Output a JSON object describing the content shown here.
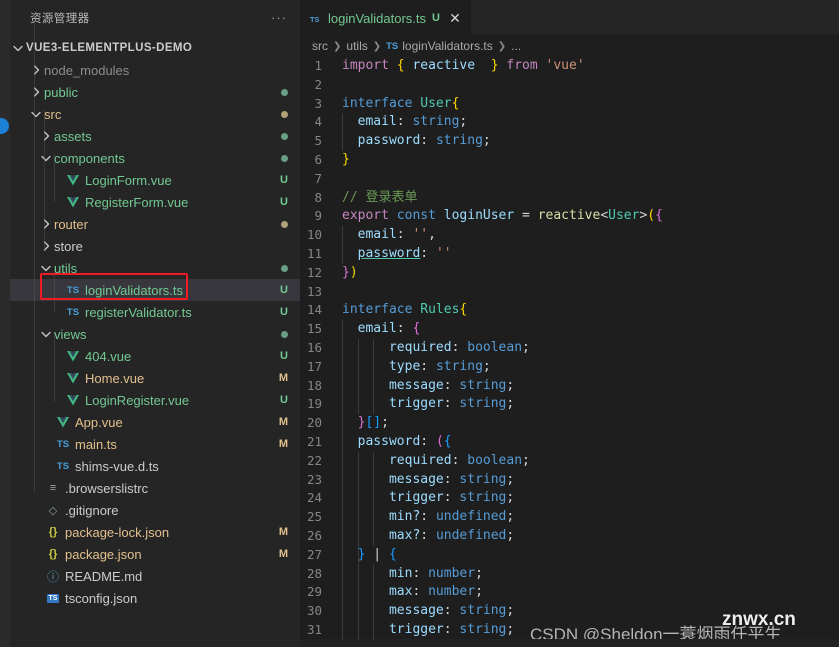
{
  "sidebar": {
    "title": "资源管理器",
    "more_label": "···",
    "root": {
      "label": "VUE3-ELEMENTPLUS-DEMO"
    },
    "items": [
      {
        "label": "node_modules",
        "icon": "chevron-right-icon",
        "kind": "folder",
        "color": "gray",
        "indent": 1,
        "badge": "",
        "dot": ""
      },
      {
        "label": "public",
        "icon": "chevron-right-icon",
        "kind": "folder",
        "color": "green",
        "indent": 1,
        "badge": "",
        "dot": "u"
      },
      {
        "label": "src",
        "icon": "chevron-down-icon",
        "kind": "folder",
        "color": "orange",
        "indent": 1,
        "badge": "",
        "dot": "m"
      },
      {
        "label": "assets",
        "icon": "chevron-right-icon",
        "kind": "folder",
        "color": "green",
        "indent": 2,
        "badge": "",
        "dot": "u"
      },
      {
        "label": "components",
        "icon": "chevron-down-icon",
        "kind": "folder",
        "color": "green",
        "indent": 2,
        "badge": "",
        "dot": "u"
      },
      {
        "label": "LoginForm.vue",
        "icon": "vue-icon",
        "kind": "file",
        "color": "green",
        "indent": 3,
        "badge": "U",
        "dot": ""
      },
      {
        "label": "RegisterForm.vue",
        "icon": "vue-icon",
        "kind": "file",
        "color": "green",
        "indent": 3,
        "badge": "U",
        "dot": ""
      },
      {
        "label": "router",
        "icon": "chevron-right-icon",
        "kind": "folder",
        "color": "orange",
        "indent": 2,
        "badge": "",
        "dot": "m"
      },
      {
        "label": "store",
        "icon": "chevron-right-icon",
        "kind": "folder",
        "color": "plain",
        "indent": 2,
        "badge": "",
        "dot": ""
      },
      {
        "label": "utils",
        "icon": "chevron-down-icon",
        "kind": "folder",
        "color": "green",
        "indent": 2,
        "badge": "",
        "dot": "u"
      },
      {
        "label": "loginValidators.ts",
        "icon": "ts-icon",
        "kind": "file",
        "color": "green",
        "indent": 3,
        "badge": "U",
        "dot": "",
        "selected": true,
        "highlighted": true
      },
      {
        "label": "registerValidator.ts",
        "icon": "ts-icon",
        "kind": "file",
        "color": "green",
        "indent": 3,
        "badge": "U",
        "dot": ""
      },
      {
        "label": "views",
        "icon": "chevron-down-icon",
        "kind": "folder",
        "color": "green",
        "indent": 2,
        "badge": "",
        "dot": "u"
      },
      {
        "label": "404.vue",
        "icon": "vue-icon",
        "kind": "file",
        "color": "green",
        "indent": 3,
        "badge": "U",
        "dot": ""
      },
      {
        "label": "Home.vue",
        "icon": "vue-icon",
        "kind": "file",
        "color": "orange",
        "indent": 3,
        "badge": "M",
        "dot": ""
      },
      {
        "label": "LoginRegister.vue",
        "icon": "vue-icon",
        "kind": "file",
        "color": "green",
        "indent": 3,
        "badge": "U",
        "dot": ""
      },
      {
        "label": "App.vue",
        "icon": "vue-icon",
        "kind": "file",
        "color": "orange",
        "indent": 2,
        "badge": "M",
        "dot": ""
      },
      {
        "label": "main.ts",
        "icon": "ts-icon",
        "kind": "file",
        "color": "orange",
        "indent": 2,
        "badge": "M",
        "dot": ""
      },
      {
        "label": "shims-vue.d.ts",
        "icon": "ts-icon",
        "kind": "file",
        "color": "plain",
        "indent": 2,
        "badge": "",
        "dot": ""
      },
      {
        "label": ".browserslistrc",
        "icon": "config-icon",
        "kind": "file",
        "color": "plain",
        "indent": 1,
        "badge": "",
        "dot": ""
      },
      {
        "label": ".gitignore",
        "icon": "gitignore-icon",
        "kind": "file",
        "color": "plain",
        "indent": 1,
        "badge": "",
        "dot": ""
      },
      {
        "label": "package-lock.json",
        "icon": "json-icon",
        "kind": "file",
        "color": "orange",
        "indent": 1,
        "badge": "M",
        "dot": ""
      },
      {
        "label": "package.json",
        "icon": "json-icon",
        "kind": "file",
        "color": "orange",
        "indent": 1,
        "badge": "M",
        "dot": ""
      },
      {
        "label": "README.md",
        "icon": "markdown-icon",
        "kind": "file",
        "color": "plain",
        "indent": 1,
        "badge": "",
        "dot": ""
      },
      {
        "label": "tsconfig.json",
        "icon": "ts-config-icon",
        "kind": "file",
        "color": "plain",
        "indent": 1,
        "badge": "",
        "dot": ""
      }
    ]
  },
  "editor": {
    "tab": {
      "name": "loginValidators.ts",
      "badge": "U",
      "close_label": "✕",
      "icon": "ts-icon"
    },
    "breadcrumb": [
      "src",
      "utils",
      "loginValidators.ts",
      "..."
    ],
    "lines": [
      {
        "n": "1",
        "tokens": [
          {
            "t": "import",
            "c": "k"
          },
          {
            "t": " ",
            "c": "pn"
          },
          {
            "t": "{",
            "c": "br1"
          },
          {
            "t": " ",
            "c": "pn"
          },
          {
            "t": "reactive",
            "c": "var"
          },
          {
            "t": "  ",
            "c": "pn"
          },
          {
            "t": "}",
            "c": "br1"
          },
          {
            "t": " ",
            "c": "pn"
          },
          {
            "t": "from",
            "c": "k"
          },
          {
            "t": " ",
            "c": "pn"
          },
          {
            "t": "'vue'",
            "c": "str"
          }
        ]
      },
      {
        "n": "2",
        "tokens": []
      },
      {
        "n": "3",
        "tokens": [
          {
            "t": "interface",
            "c": "kw2"
          },
          {
            "t": " ",
            "c": "pn"
          },
          {
            "t": "User",
            "c": "typ"
          },
          {
            "t": "{",
            "c": "br1"
          }
        ]
      },
      {
        "n": "4",
        "tokens": [
          {
            "t": "  ",
            "c": "pn"
          },
          {
            "t": "email",
            "c": "var"
          },
          {
            "t": ": ",
            "c": "pn"
          },
          {
            "t": "string",
            "c": "kw2"
          },
          {
            "t": ";",
            "c": "pn"
          }
        ]
      },
      {
        "n": "5",
        "tokens": [
          {
            "t": "  ",
            "c": "pn"
          },
          {
            "t": "password",
            "c": "var"
          },
          {
            "t": ": ",
            "c": "pn"
          },
          {
            "t": "string",
            "c": "kw2"
          },
          {
            "t": ";",
            "c": "pn"
          }
        ]
      },
      {
        "n": "6",
        "tokens": [
          {
            "t": "}",
            "c": "br1"
          }
        ]
      },
      {
        "n": "7",
        "tokens": []
      },
      {
        "n": "8",
        "tokens": [
          {
            "t": "// 登录表单",
            "c": "cmt"
          }
        ]
      },
      {
        "n": "9",
        "tokens": [
          {
            "t": "export",
            "c": "k"
          },
          {
            "t": " ",
            "c": "pn"
          },
          {
            "t": "const",
            "c": "kw2"
          },
          {
            "t": " ",
            "c": "pn"
          },
          {
            "t": "loginUser",
            "c": "var"
          },
          {
            "t": " ",
            "c": "pn"
          },
          {
            "t": "=",
            "c": "op"
          },
          {
            "t": " ",
            "c": "pn"
          },
          {
            "t": "reactive",
            "c": "fn"
          },
          {
            "t": "<",
            "c": "pn"
          },
          {
            "t": "User",
            "c": "typ"
          },
          {
            "t": ">",
            "c": "pn"
          },
          {
            "t": "(",
            "c": "br1"
          },
          {
            "t": "{",
            "c": "br2"
          }
        ]
      },
      {
        "n": "10",
        "tokens": [
          {
            "t": "  ",
            "c": "pn"
          },
          {
            "t": "email",
            "c": "var"
          },
          {
            "t": ": ",
            "c": "pn"
          },
          {
            "t": "''",
            "c": "str"
          },
          {
            "t": ",",
            "c": "pn"
          }
        ]
      },
      {
        "n": "11",
        "tokens": [
          {
            "t": "  ",
            "c": "pn"
          },
          {
            "t": "password",
            "c": "var spell"
          },
          {
            "t": ": ",
            "c": "pn"
          },
          {
            "t": "''",
            "c": "str"
          }
        ]
      },
      {
        "n": "12",
        "tokens": [
          {
            "t": "}",
            "c": "br2"
          },
          {
            "t": ")",
            "c": "br1"
          }
        ]
      },
      {
        "n": "13",
        "tokens": []
      },
      {
        "n": "14",
        "tokens": [
          {
            "t": "interface",
            "c": "kw2"
          },
          {
            "t": " ",
            "c": "pn"
          },
          {
            "t": "Rules",
            "c": "typ"
          },
          {
            "t": "{",
            "c": "br1"
          }
        ]
      },
      {
        "n": "15",
        "tokens": [
          {
            "t": "  ",
            "c": "pn"
          },
          {
            "t": "email",
            "c": "var"
          },
          {
            "t": ": ",
            "c": "pn"
          },
          {
            "t": "{",
            "c": "br2"
          }
        ]
      },
      {
        "n": "16",
        "tokens": [
          {
            "t": "      ",
            "c": "pn"
          },
          {
            "t": "required",
            "c": "var"
          },
          {
            "t": ": ",
            "c": "pn"
          },
          {
            "t": "boolean",
            "c": "kw2"
          },
          {
            "t": ";",
            "c": "pn"
          }
        ]
      },
      {
        "n": "17",
        "tokens": [
          {
            "t": "      ",
            "c": "pn"
          },
          {
            "t": "type",
            "c": "var"
          },
          {
            "t": ": ",
            "c": "pn"
          },
          {
            "t": "string",
            "c": "kw2"
          },
          {
            "t": ";",
            "c": "pn"
          }
        ]
      },
      {
        "n": "18",
        "tokens": [
          {
            "t": "      ",
            "c": "pn"
          },
          {
            "t": "message",
            "c": "var"
          },
          {
            "t": ": ",
            "c": "pn"
          },
          {
            "t": "string",
            "c": "kw2"
          },
          {
            "t": ";",
            "c": "pn"
          }
        ]
      },
      {
        "n": "19",
        "tokens": [
          {
            "t": "      ",
            "c": "pn"
          },
          {
            "t": "trigger",
            "c": "var"
          },
          {
            "t": ": ",
            "c": "pn"
          },
          {
            "t": "string",
            "c": "kw2"
          },
          {
            "t": ";",
            "c": "pn"
          }
        ]
      },
      {
        "n": "20",
        "tokens": [
          {
            "t": "  ",
            "c": "pn"
          },
          {
            "t": "}",
            "c": "br2"
          },
          {
            "t": "[]",
            "c": "br3"
          },
          {
            "t": ";",
            "c": "pn"
          }
        ]
      },
      {
        "n": "21",
        "tokens": [
          {
            "t": "  ",
            "c": "pn"
          },
          {
            "t": "password",
            "c": "var"
          },
          {
            "t": ": ",
            "c": "pn"
          },
          {
            "t": "(",
            "c": "br2"
          },
          {
            "t": "{",
            "c": "br3"
          }
        ]
      },
      {
        "n": "22",
        "tokens": [
          {
            "t": "      ",
            "c": "pn"
          },
          {
            "t": "required",
            "c": "var"
          },
          {
            "t": ": ",
            "c": "pn"
          },
          {
            "t": "boolean",
            "c": "kw2"
          },
          {
            "t": ";",
            "c": "pn"
          }
        ]
      },
      {
        "n": "23",
        "tokens": [
          {
            "t": "      ",
            "c": "pn"
          },
          {
            "t": "message",
            "c": "var"
          },
          {
            "t": ": ",
            "c": "pn"
          },
          {
            "t": "string",
            "c": "kw2"
          },
          {
            "t": ";",
            "c": "pn"
          }
        ]
      },
      {
        "n": "24",
        "tokens": [
          {
            "t": "      ",
            "c": "pn"
          },
          {
            "t": "trigger",
            "c": "var"
          },
          {
            "t": ": ",
            "c": "pn"
          },
          {
            "t": "string",
            "c": "kw2"
          },
          {
            "t": ";",
            "c": "pn"
          }
        ]
      },
      {
        "n": "25",
        "tokens": [
          {
            "t": "      ",
            "c": "pn"
          },
          {
            "t": "min?",
            "c": "var"
          },
          {
            "t": ": ",
            "c": "pn"
          },
          {
            "t": "undefined",
            "c": "kw2"
          },
          {
            "t": ";",
            "c": "pn"
          }
        ]
      },
      {
        "n": "26",
        "tokens": [
          {
            "t": "      ",
            "c": "pn"
          },
          {
            "t": "max?",
            "c": "var"
          },
          {
            "t": ": ",
            "c": "pn"
          },
          {
            "t": "undefined",
            "c": "kw2"
          },
          {
            "t": ";",
            "c": "pn"
          }
        ]
      },
      {
        "n": "27",
        "tokens": [
          {
            "t": "  ",
            "c": "pn"
          },
          {
            "t": "}",
            "c": "br3"
          },
          {
            "t": " | ",
            "c": "pn"
          },
          {
            "t": "{",
            "c": "br3"
          }
        ]
      },
      {
        "n": "28",
        "tokens": [
          {
            "t": "      ",
            "c": "pn"
          },
          {
            "t": "min",
            "c": "var"
          },
          {
            "t": ": ",
            "c": "pn"
          },
          {
            "t": "number",
            "c": "kw2"
          },
          {
            "t": ";",
            "c": "pn"
          }
        ]
      },
      {
        "n": "29",
        "tokens": [
          {
            "t": "      ",
            "c": "pn"
          },
          {
            "t": "max",
            "c": "var"
          },
          {
            "t": ": ",
            "c": "pn"
          },
          {
            "t": "number",
            "c": "kw2"
          },
          {
            "t": ";",
            "c": "pn"
          }
        ]
      },
      {
        "n": "30",
        "tokens": [
          {
            "t": "      ",
            "c": "pn"
          },
          {
            "t": "message",
            "c": "var"
          },
          {
            "t": ": ",
            "c": "pn"
          },
          {
            "t": "string",
            "c": "kw2"
          },
          {
            "t": ";",
            "c": "pn"
          }
        ]
      },
      {
        "n": "31",
        "tokens": [
          {
            "t": "      ",
            "c": "pn"
          },
          {
            "t": "trigger",
            "c": "var"
          },
          {
            "t": ": ",
            "c": "pn"
          },
          {
            "t": "string",
            "c": "kw2"
          },
          {
            "t": ";",
            "c": "pn"
          }
        ]
      }
    ]
  },
  "watermark": {
    "text": "CSDN @Sheldon一蓑烟雨任平生",
    "overlay": "znwx.cn"
  },
  "colors": {
    "sidebar_bg": "#252526",
    "editor_bg": "#1e1e1e",
    "selection": "#37373d",
    "highlight_box": "#ee1c25",
    "green": "#73c991",
    "orange": "#e2c08d"
  }
}
